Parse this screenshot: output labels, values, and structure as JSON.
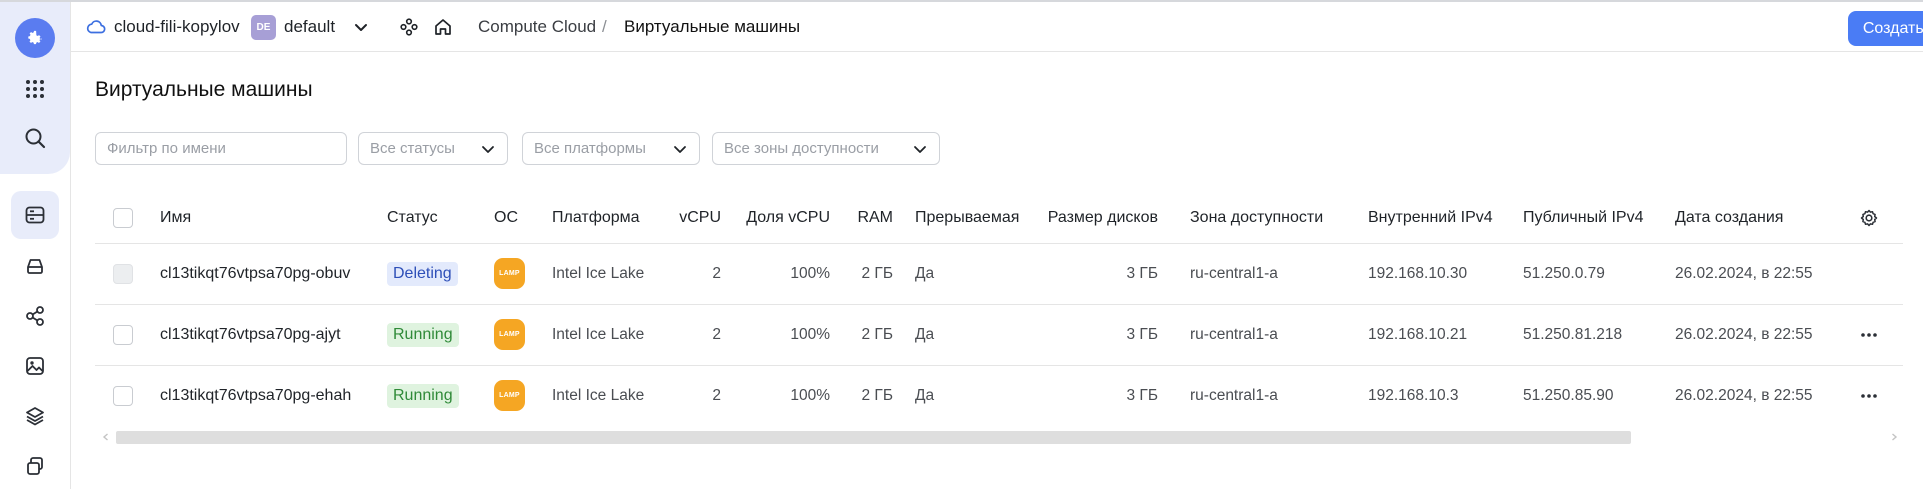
{
  "header": {
    "cloud_name": "cloud-fili-kopylov",
    "folder_badge": "DE",
    "folder_name": "default",
    "breadcrumb_service": "Compute Cloud",
    "breadcrumb_separator": "/",
    "breadcrumb_current": "Виртуальные машины",
    "create_button": "Создать ВМ"
  },
  "page_title": "Виртуальные машины",
  "filters": {
    "name_placeholder": "Фильтр по имени",
    "status": "Все статусы",
    "platform": "Все платформы",
    "zone": "Все зоны доступности"
  },
  "table": {
    "columns": {
      "name": "Имя",
      "status": "Статус",
      "os": "ОС",
      "platform": "Платформа",
      "vcpu": "vCPU",
      "vcpu_share": "Доля vCPU",
      "ram": "RAM",
      "preemptible": "Прерываемая",
      "disk_size": "Размер дисков",
      "zone": "Зона доступности",
      "ip_internal": "Внутренний IPv4",
      "ip_public": "Публичный IPv4",
      "created": "Дата создания"
    },
    "rows": [
      {
        "name": "cl13tikqt76vtpsa70pg-obuv",
        "status": "Deleting",
        "os": "LAMP",
        "platform": "Intel Ice Lake",
        "vcpu": "2",
        "vcpu_share": "100%",
        "ram": "2 ГБ",
        "preemptible": "Да",
        "disk_size": "3 ГБ",
        "zone": "ru-central1-a",
        "ip_internal": "192.168.10.30",
        "ip_public": "51.250.0.79",
        "created": "26.02.2024, в 22:55"
      },
      {
        "name": "cl13tikqt76vtpsa70pg-ajyt",
        "status": "Running",
        "os": "LAMP",
        "platform": "Intel Ice Lake",
        "vcpu": "2",
        "vcpu_share": "100%",
        "ram": "2 ГБ",
        "preemptible": "Да",
        "disk_size": "3 ГБ",
        "zone": "ru-central1-a",
        "ip_internal": "192.168.10.21",
        "ip_public": "51.250.81.218",
        "created": "26.02.2024, в 22:55"
      },
      {
        "name": "cl13tikqt76vtpsa70pg-ehah",
        "status": "Running",
        "os": "LAMP",
        "platform": "Intel Ice Lake",
        "vcpu": "2",
        "vcpu_share": "100%",
        "ram": "2 ГБ",
        "preemptible": "Да",
        "disk_size": "3 ГБ",
        "zone": "ru-central1-a",
        "ip_internal": "192.168.10.3",
        "ip_public": "51.250.85.90",
        "created": "26.02.2024, в 22:55"
      }
    ]
  },
  "icons": {
    "logo": "gear-logo-icon",
    "apps": "grid-icon",
    "search": "search-icon",
    "nav": [
      "vm-icon",
      "disk-icon",
      "network-icon",
      "image-icon",
      "layers-icon",
      "snapshot-icon"
    ],
    "settings": "gear-icon",
    "row_menu": "more-icon"
  },
  "colors": {
    "accent": "#4a7cf5",
    "deleting_bg": "#e3eafc",
    "running_bg": "#dff3df",
    "lamp": "#f5a623"
  }
}
